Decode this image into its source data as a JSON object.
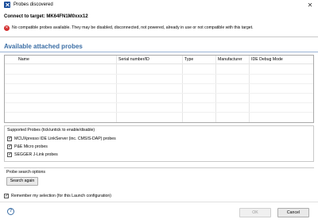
{
  "window": {
    "title": "Probes discovered",
    "close_glyph": "✕"
  },
  "header": {
    "connect_title": "Connect to target: MK64FN1M0xxx12",
    "warning": "No compatible probes available. They may be disabled, disconnected, not powered, already in use or not compatible with this target.",
    "error_icon_glyph": "✕"
  },
  "probes_table": {
    "title": "Available attached probes",
    "columns": [
      "Name",
      "Serial number/ID",
      "Type",
      "Manufacturer",
      "IDE Debug Mode"
    ],
    "rows": []
  },
  "supported_probes": {
    "title": "Supported Probes (tick/untick to enable/disable)",
    "items": [
      {
        "label": "MCUXpresso IDE LinkServer (inc. CMSIS-DAP) probes",
        "checked": true
      },
      {
        "label": "P&E Micro probes",
        "checked": true
      },
      {
        "label": "SEGGER J-Link probes",
        "checked": true
      }
    ]
  },
  "search": {
    "title": "Probe search options",
    "button_label": "Search again"
  },
  "remember": {
    "label": "Remember my selection (for this Launch configuration)",
    "checked": true
  },
  "footer": {
    "help_glyph": "?",
    "ok_label": "OK",
    "cancel_label": "Cancel"
  },
  "colors": {
    "accent": "#3b6ea5",
    "error": "#d32f2f"
  }
}
